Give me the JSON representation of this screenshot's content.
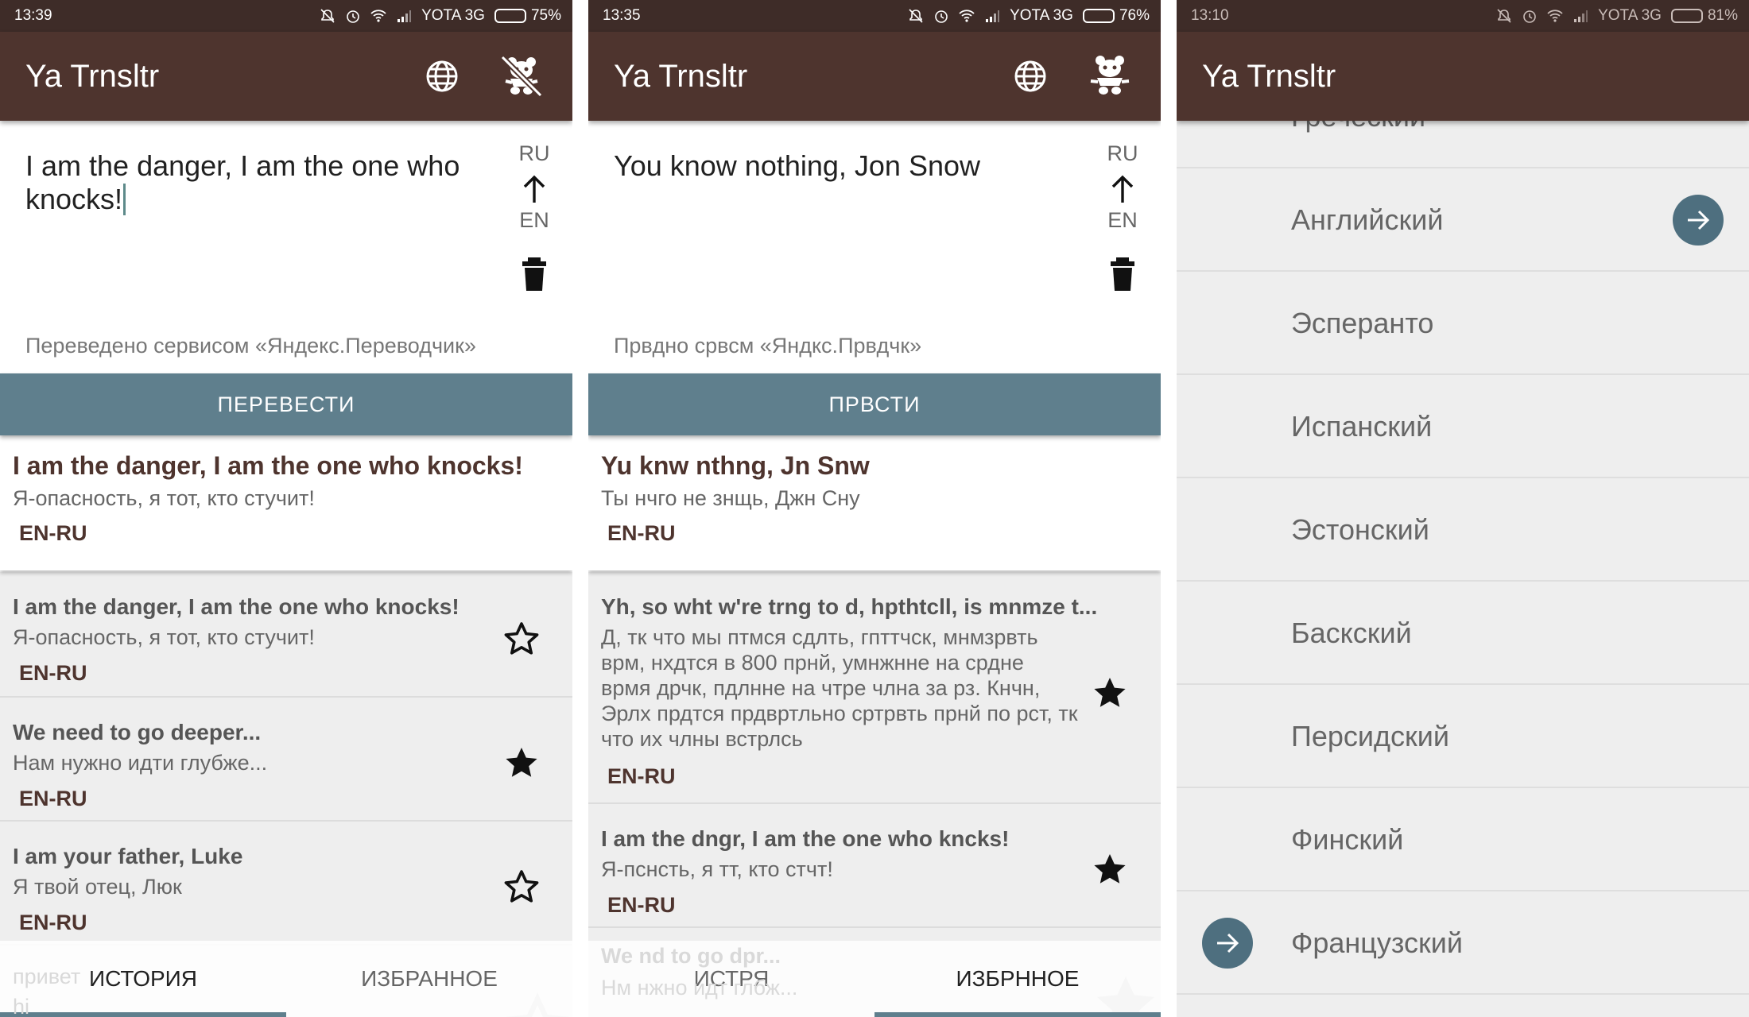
{
  "screens": [
    {
      "status": {
        "time": "13:39",
        "carrier": "YOTA 3G",
        "battery": "75%",
        "battery_level": 0.75
      },
      "appbar": {
        "title": "Ya Trnsltr",
        "icons": [
          "globe-icon",
          "bear-crossed-icon"
        ]
      },
      "input": {
        "text": "I am the danger, I am the one who knocks!",
        "lang_from": "RU",
        "lang_to": "EN"
      },
      "attribution": "Переведено сервисом «Яндекс.Переводчик»",
      "translate_button": "ПЕРЕВЕСТИ",
      "result": {
        "source": "I am the danger, I am the one who knocks!",
        "translation": "Я-опасность, я тот, кто стучит!",
        "pair": "EN-RU"
      },
      "history": [
        {
          "source": "I am the danger, I am the one who knocks!",
          "translation": "Я-опасность, я тот, кто стучит!",
          "pair": "EN-RU",
          "starred": false
        },
        {
          "source": "We need to go deeper...",
          "translation": "Нам нужно идти глубже...",
          "pair": "EN-RU",
          "starred": true
        },
        {
          "source": "I am your father, Luke",
          "translation": "Я твой отец, Люк",
          "pair": "EN-RU",
          "starred": false
        }
      ],
      "ghost": {
        "src": "привет",
        "tr": "hi"
      },
      "tabs": [
        {
          "label": "ИСТОРИЯ",
          "active": true
        },
        {
          "label": "ИЗБРАННОЕ",
          "active": false
        }
      ]
    },
    {
      "status": {
        "time": "13:35",
        "carrier": "YOTA 3G",
        "battery": "76%",
        "battery_level": 0.76
      },
      "appbar": {
        "title": "Ya Trnsltr",
        "icons": [
          "globe-icon",
          "bear-icon"
        ]
      },
      "input": {
        "text": "You know nothing, Jon Snow",
        "lang_from": "RU",
        "lang_to": "EN"
      },
      "attribution": "Првдно срвсм «Яндкс.Првдчк»",
      "translate_button": "ПРВСТИ",
      "result": {
        "source": "Yu knw nthng, Jn Snw",
        "translation": "Ты нчго не знщь, Джн Сну",
        "pair": "EN-RU"
      },
      "history": [
        {
          "source": "Yh, so wht w're trng to d, hpthtcll, is mnmze t...",
          "translation": "Д, тк что мы птмся сдлть, гпттчск, мнмзрвть врм, нхдтся в 800 прнй, умнжнне на срдне врмя дрчк, пдлнне на чтре члна за рз. Кнчн, Эрлх прдтся прдвртльно сртрвть прнй по рст, тк что их члны встрлсь",
          "pair": "EN-RU",
          "starred": true
        },
        {
          "source": "I am the dngr, I am the one who kncks!",
          "translation": "Я-пснсть, я тт, кто стчт!",
          "pair": "EN-RU",
          "starred": true
        }
      ],
      "ghost": {
        "src": "We nd to go dpr...",
        "tr": "Нм нжно идт глбж..."
      },
      "tabs": [
        {
          "label": "ИСТРЯ",
          "active": false
        },
        {
          "label": "ИЗБРННОЕ",
          "active": true
        }
      ]
    },
    {
      "status": {
        "time": "13:10",
        "carrier": "YOTA 3G",
        "battery": "81%",
        "battery_level": 0.81
      },
      "appbar": {
        "title": "Ya Trnsltr"
      },
      "languages": [
        {
          "name": "Греческий",
          "marker": null
        },
        {
          "name": "Английский",
          "marker": "right"
        },
        {
          "name": "Эсперанто",
          "marker": null
        },
        {
          "name": "Испанский",
          "marker": null
        },
        {
          "name": "Эстонский",
          "marker": null
        },
        {
          "name": "Баскский",
          "marker": null
        },
        {
          "name": "Персидский",
          "marker": null
        },
        {
          "name": "Финский",
          "marker": null
        },
        {
          "name": "Французский",
          "marker": "left"
        }
      ]
    }
  ]
}
